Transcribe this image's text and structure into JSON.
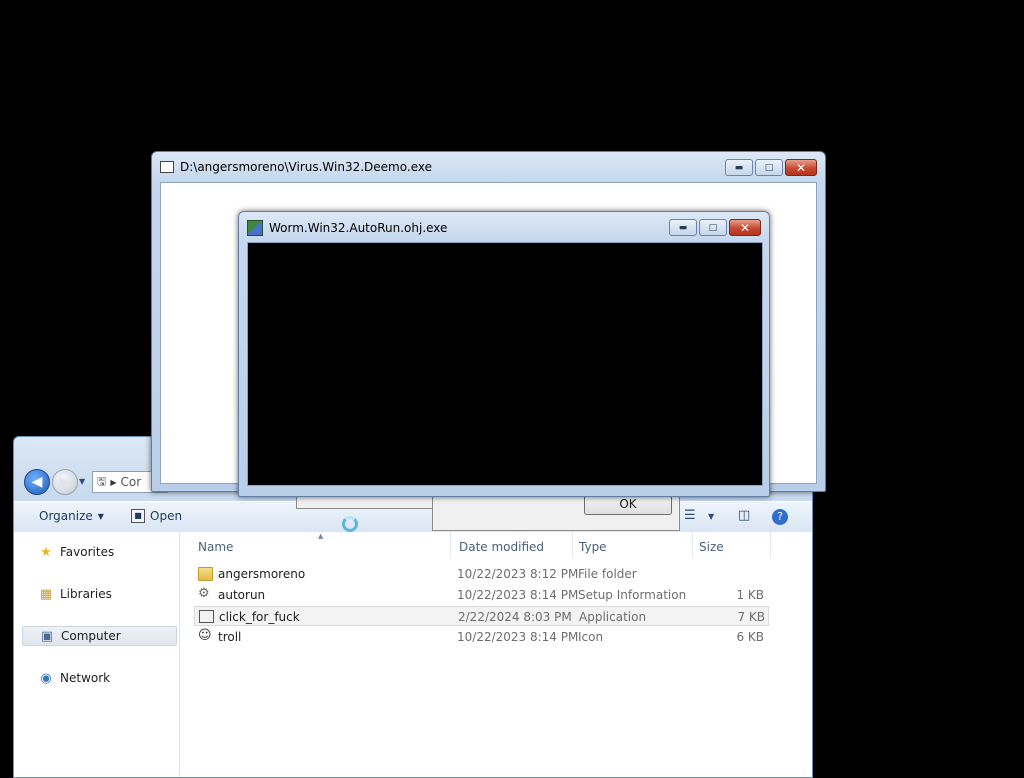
{
  "explorer": {
    "address_text": "Cor",
    "toolbar": {
      "organize_label": "Organize",
      "open_label": "Open"
    },
    "nav": [
      {
        "label": "Favorites",
        "icon": "star-icon"
      },
      {
        "label": "Libraries",
        "icon": "libraries-icon"
      },
      {
        "label": "Computer",
        "icon": "computer-icon",
        "selected": true
      },
      {
        "label": "Network",
        "icon": "network-icon"
      }
    ],
    "columns": {
      "name": "Name",
      "date": "Date modified",
      "type": "Type",
      "size": "Size"
    },
    "files": [
      {
        "name": "angersmoreno",
        "date": "10/22/2023 8:12 PM",
        "type": "File folder",
        "size": "",
        "icon": "folder-icon"
      },
      {
        "name": "autorun",
        "date": "10/22/2023 8:14 PM",
        "type": "Setup Information",
        "size": "1 KB",
        "icon": "settings-file-icon"
      },
      {
        "name": "click_for_fuck",
        "date": "2/22/2024 8:03 PM",
        "type": "Application",
        "size": "7 KB",
        "icon": "application-icon",
        "selected": true
      },
      {
        "name": "troll",
        "date": "10/22/2023 8:14 PM",
        "type": "Icon",
        "size": "6 KB",
        "icon": "icon-file-icon"
      }
    ]
  },
  "msgbox": {
    "ok_label": "OK"
  },
  "windows": {
    "deemo": {
      "title": "D:\\angersmoreno\\Virus.Win32.Deemo.exe"
    },
    "worm": {
      "title": "Worm.Win32.AutoRun.ohj.exe"
    }
  }
}
